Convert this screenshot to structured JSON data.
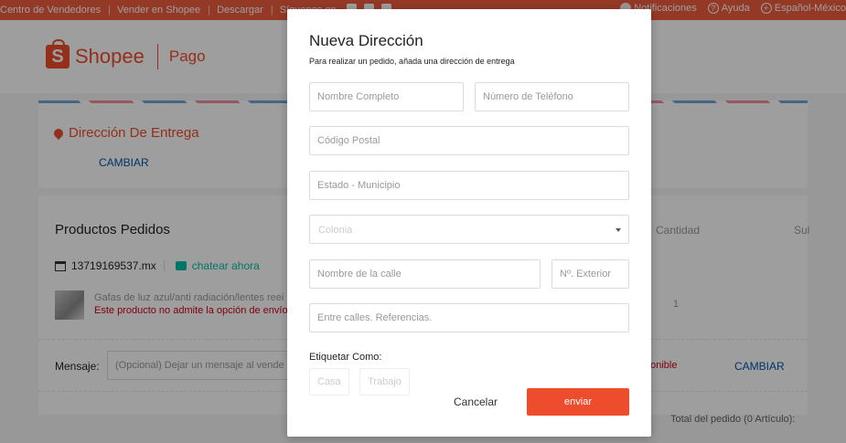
{
  "topbar": {
    "seller_center": "Centro de Vendedores",
    "sell": "Vender en Shopee",
    "download": "Descargar",
    "follow": "Síguenos en",
    "notifications": "Notificaciones",
    "help": "Ayuda",
    "language": "Español-México"
  },
  "header": {
    "brand": "Shopee",
    "section": "Pago"
  },
  "address": {
    "title": "Dirección De Entrega",
    "change": "CAMBIAR"
  },
  "products": {
    "title": "Productos Pedidos",
    "col_quantity": "Cantidad",
    "col_subtotal": "Sul",
    "shop_name": "13719169537.mx",
    "chat": "chatear ahora",
    "item_name": "Gafas de luz azul/anti radiación/lentes reei",
    "item_warning": "Este producto no admite la opción de envío",
    "item_qty": "1",
    "message_label": "Mensaje:",
    "message_placeholder": "(Opcional) Dejar un mensaje al vende",
    "shipping_unavailable": "ponible",
    "shipping_change": "CAMBIAR",
    "order_total": "Total del pedido (0 Artículo):"
  },
  "modal": {
    "title": "Nueva Dirección",
    "subtitle": "Para realizar un pedido, añada una dirección de entrega",
    "fields": {
      "full_name": "Nombre Completo",
      "phone": "Número de Teléfono",
      "postal_code": "Código Postal",
      "state": "Estado - Municipio",
      "colonia": "Colonia",
      "street": "Nombre de la calle",
      "exterior": "Nº. Exterior",
      "references": "Entre calles. Referencias."
    },
    "tag_label": "Etiquetar Como:",
    "tags": [
      "Casa",
      "Trabajo"
    ],
    "cancel": "Cancelar",
    "submit": "enviar"
  },
  "colors": {
    "brand": "#ee4d2d",
    "topbar": "#f05d40",
    "link": "#0055aa",
    "chat": "#00bfa5"
  },
  "icons": [
    "bell-icon",
    "help-icon",
    "globe-icon",
    "location-pin-icon",
    "store-icon",
    "chat-icon",
    "chevron-down-icon"
  ]
}
